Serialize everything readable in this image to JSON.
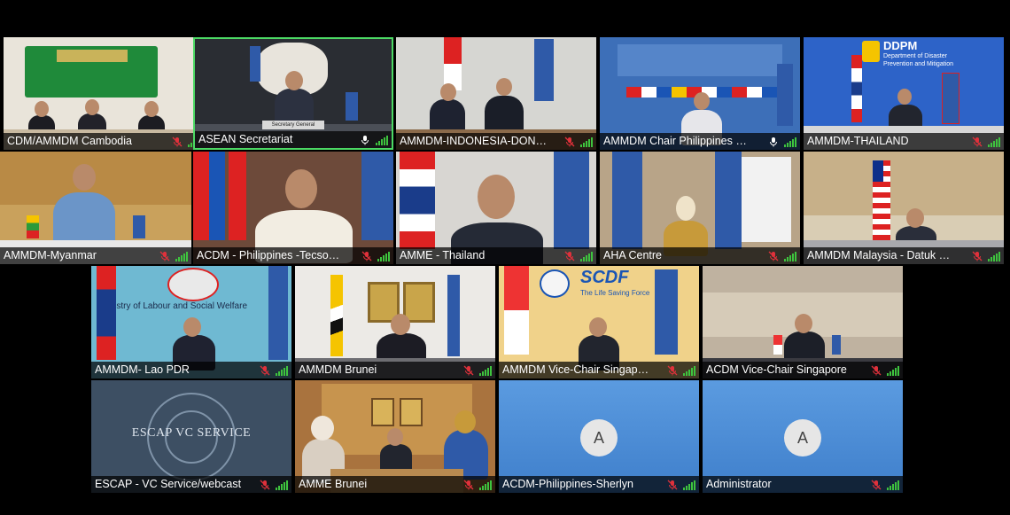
{
  "participants": [
    {
      "name": "CDM/AMMDM Cambodia",
      "mic": "muted"
    },
    {
      "name": "ASEAN Secretariat",
      "mic": "on"
    },
    {
      "name": "AMMDM-INDONESIA-DONI MO...",
      "mic": "muted"
    },
    {
      "name": "AMMDM Chair Philippines Usec...",
      "mic": "on"
    },
    {
      "name": "AMMDM-THAILAND",
      "mic": "muted"
    },
    {
      "name": "AMMDM-Myanmar",
      "mic": "muted"
    },
    {
      "name": "ACDM - Philippines -Tecson Jo...",
      "mic": "muted"
    },
    {
      "name": "AMME - Thailand",
      "mic": "muted"
    },
    {
      "name": "AHA Centre",
      "mic": "muted"
    },
    {
      "name": "AMMDM Malaysia - Datuk Dr A...",
      "mic": "muted"
    },
    {
      "name": "AMMDM- Lao PDR",
      "mic": "muted"
    },
    {
      "name": "AMMDM Brunei",
      "mic": "muted"
    },
    {
      "name": "AMMDM Vice-Chair Singapore",
      "mic": "muted"
    },
    {
      "name": "ACDM Vice-Chair Singapore",
      "mic": "muted"
    },
    {
      "name": "ESCAP - VC Service/webcast",
      "mic": "muted"
    },
    {
      "name": "AMME Brunei",
      "mic": "muted"
    },
    {
      "name": "ACDM-Philippines-Sherlyn",
      "mic": "muted",
      "avatar": "A"
    },
    {
      "name": "Administrator",
      "mic": "muted",
      "avatar": "A"
    }
  ],
  "scene_text": {
    "ddpm_title": "DDPM",
    "ddpm_sub1": "Department of Disaster",
    "ddpm_sub2": "Prevention and Mitigation",
    "lao_banner": "Ministry of Labour and Social Welfare",
    "scdf_logo": "SCDF",
    "scdf_tag": "The Life Saving Force",
    "escap_banner": "ESCAP VC SERVICE",
    "asean_nameplate": "Secretary General"
  },
  "colors": {
    "active_speaker_border": "#4cd964",
    "muted_mic": "#e0313b",
    "signal": "#3ec43e",
    "avatar_bg": "#4a8bd6"
  }
}
